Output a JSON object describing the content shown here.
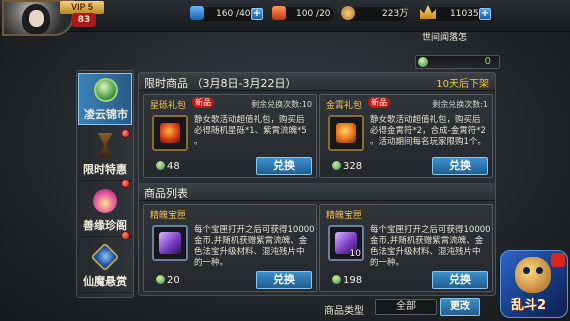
{
  "player": {
    "vip": "VIP 5",
    "level": "83"
  },
  "resources": {
    "stamina": "160 /40",
    "energy": "100 /20",
    "copper": "223万",
    "gold": "11035"
  },
  "location": "世间闻落怎",
  "currency_strip": {
    "value": "0"
  },
  "sidebar": {
    "items": [
      {
        "label": "凌云锦市",
        "icon": "jade-coin-icon",
        "active": true,
        "red_dot": false
      },
      {
        "label": "限时特惠",
        "icon": "hourglass-icon",
        "active": false,
        "red_dot": true
      },
      {
        "label": "善缘珍阁",
        "icon": "lotus-icon",
        "active": false,
        "red_dot": true
      },
      {
        "label": "仙魔悬赏",
        "icon": "demon-mask-icon",
        "active": false,
        "red_dot": true
      }
    ]
  },
  "limited": {
    "title": "限时商品",
    "dates": "（3月8日-3月22日）",
    "countdown": "10天后下架",
    "items": [
      {
        "name": "星砾礼包",
        "badge": "新品",
        "remain": "剩余兑换次数:10",
        "desc": [
          "静女歌活动超值礼包，购买后",
          "必得随机星砾*1、紫霄流魄*5",
          "。"
        ],
        "price": "48",
        "button": "兑换"
      },
      {
        "name": "金霄礼包",
        "badge": "新品",
        "remain": "剩余兑换次数:1",
        "desc": [
          "静女歌活动超值礼包，购买后",
          "必得金霄符*2，合成-金霄符*2",
          "。活动期间每名玩家限购1个。"
        ],
        "price": "328",
        "button": "兑换"
      }
    ]
  },
  "product_list": {
    "title": "商品列表",
    "items": [
      {
        "name": "精魄宝匣",
        "thumb_count": "",
        "desc": [
          "每个宝匣打开之后可获得10000",
          "金币,并随机获赠紫霄流魄、金",
          "色法宝升级材料、混沌残片中",
          "的一种。"
        ],
        "price": "20",
        "button": "兑换"
      },
      {
        "name": "精魄宝匣",
        "thumb_count": "10",
        "desc": [
          "每个宝匣打开之后可获得10000",
          "金币,并随机获赠紫霄流魄、金",
          "色法宝升级材料、混沌残片中",
          "的一种。"
        ],
        "price": "198",
        "button": "兑换"
      }
    ]
  },
  "filter": {
    "label": "商品类型",
    "value": "全部",
    "change_button": "更改"
  },
  "logo": {
    "title": "乱斗2"
  },
  "colors": {
    "accent_blue": "#3b8fc9",
    "gold_text": "#f2c150",
    "green_text": "#5fd44a",
    "new_badge": "#c21714"
  }
}
